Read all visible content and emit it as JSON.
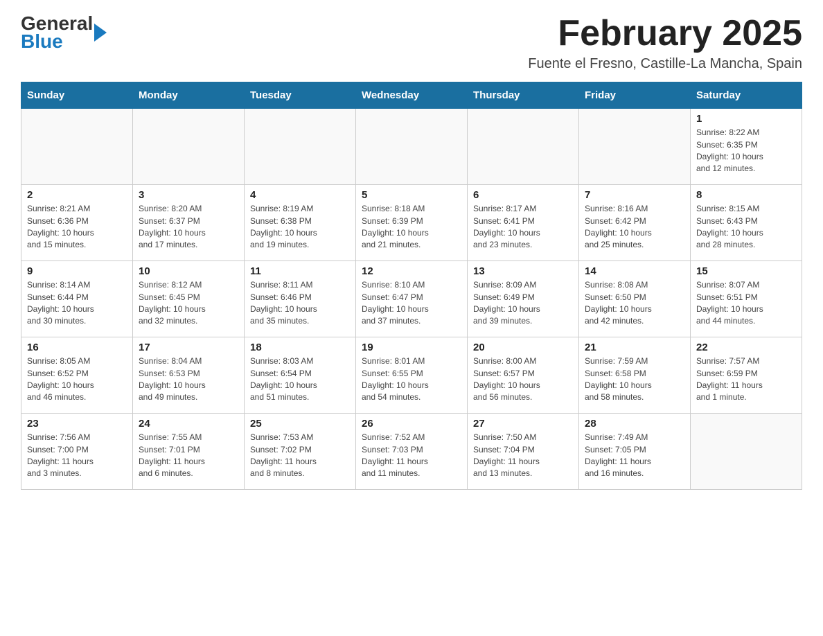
{
  "header": {
    "logo_general": "General",
    "logo_blue": "Blue",
    "month_title": "February 2025",
    "location": "Fuente el Fresno, Castille-La Mancha, Spain"
  },
  "weekdays": [
    "Sunday",
    "Monday",
    "Tuesday",
    "Wednesday",
    "Thursday",
    "Friday",
    "Saturday"
  ],
  "weeks": [
    [
      {
        "day": "",
        "info": ""
      },
      {
        "day": "",
        "info": ""
      },
      {
        "day": "",
        "info": ""
      },
      {
        "day": "",
        "info": ""
      },
      {
        "day": "",
        "info": ""
      },
      {
        "day": "",
        "info": ""
      },
      {
        "day": "1",
        "info": "Sunrise: 8:22 AM\nSunset: 6:35 PM\nDaylight: 10 hours\nand 12 minutes."
      }
    ],
    [
      {
        "day": "2",
        "info": "Sunrise: 8:21 AM\nSunset: 6:36 PM\nDaylight: 10 hours\nand 15 minutes."
      },
      {
        "day": "3",
        "info": "Sunrise: 8:20 AM\nSunset: 6:37 PM\nDaylight: 10 hours\nand 17 minutes."
      },
      {
        "day": "4",
        "info": "Sunrise: 8:19 AM\nSunset: 6:38 PM\nDaylight: 10 hours\nand 19 minutes."
      },
      {
        "day": "5",
        "info": "Sunrise: 8:18 AM\nSunset: 6:39 PM\nDaylight: 10 hours\nand 21 minutes."
      },
      {
        "day": "6",
        "info": "Sunrise: 8:17 AM\nSunset: 6:41 PM\nDaylight: 10 hours\nand 23 minutes."
      },
      {
        "day": "7",
        "info": "Sunrise: 8:16 AM\nSunset: 6:42 PM\nDaylight: 10 hours\nand 25 minutes."
      },
      {
        "day": "8",
        "info": "Sunrise: 8:15 AM\nSunset: 6:43 PM\nDaylight: 10 hours\nand 28 minutes."
      }
    ],
    [
      {
        "day": "9",
        "info": "Sunrise: 8:14 AM\nSunset: 6:44 PM\nDaylight: 10 hours\nand 30 minutes."
      },
      {
        "day": "10",
        "info": "Sunrise: 8:12 AM\nSunset: 6:45 PM\nDaylight: 10 hours\nand 32 minutes."
      },
      {
        "day": "11",
        "info": "Sunrise: 8:11 AM\nSunset: 6:46 PM\nDaylight: 10 hours\nand 35 minutes."
      },
      {
        "day": "12",
        "info": "Sunrise: 8:10 AM\nSunset: 6:47 PM\nDaylight: 10 hours\nand 37 minutes."
      },
      {
        "day": "13",
        "info": "Sunrise: 8:09 AM\nSunset: 6:49 PM\nDaylight: 10 hours\nand 39 minutes."
      },
      {
        "day": "14",
        "info": "Sunrise: 8:08 AM\nSunset: 6:50 PM\nDaylight: 10 hours\nand 42 minutes."
      },
      {
        "day": "15",
        "info": "Sunrise: 8:07 AM\nSunset: 6:51 PM\nDaylight: 10 hours\nand 44 minutes."
      }
    ],
    [
      {
        "day": "16",
        "info": "Sunrise: 8:05 AM\nSunset: 6:52 PM\nDaylight: 10 hours\nand 46 minutes."
      },
      {
        "day": "17",
        "info": "Sunrise: 8:04 AM\nSunset: 6:53 PM\nDaylight: 10 hours\nand 49 minutes."
      },
      {
        "day": "18",
        "info": "Sunrise: 8:03 AM\nSunset: 6:54 PM\nDaylight: 10 hours\nand 51 minutes."
      },
      {
        "day": "19",
        "info": "Sunrise: 8:01 AM\nSunset: 6:55 PM\nDaylight: 10 hours\nand 54 minutes."
      },
      {
        "day": "20",
        "info": "Sunrise: 8:00 AM\nSunset: 6:57 PM\nDaylight: 10 hours\nand 56 minutes."
      },
      {
        "day": "21",
        "info": "Sunrise: 7:59 AM\nSunset: 6:58 PM\nDaylight: 10 hours\nand 58 minutes."
      },
      {
        "day": "22",
        "info": "Sunrise: 7:57 AM\nSunset: 6:59 PM\nDaylight: 11 hours\nand 1 minute."
      }
    ],
    [
      {
        "day": "23",
        "info": "Sunrise: 7:56 AM\nSunset: 7:00 PM\nDaylight: 11 hours\nand 3 minutes."
      },
      {
        "day": "24",
        "info": "Sunrise: 7:55 AM\nSunset: 7:01 PM\nDaylight: 11 hours\nand 6 minutes."
      },
      {
        "day": "25",
        "info": "Sunrise: 7:53 AM\nSunset: 7:02 PM\nDaylight: 11 hours\nand 8 minutes."
      },
      {
        "day": "26",
        "info": "Sunrise: 7:52 AM\nSunset: 7:03 PM\nDaylight: 11 hours\nand 11 minutes."
      },
      {
        "day": "27",
        "info": "Sunrise: 7:50 AM\nSunset: 7:04 PM\nDaylight: 11 hours\nand 13 minutes."
      },
      {
        "day": "28",
        "info": "Sunrise: 7:49 AM\nSunset: 7:05 PM\nDaylight: 11 hours\nand 16 minutes."
      },
      {
        "day": "",
        "info": ""
      }
    ]
  ]
}
